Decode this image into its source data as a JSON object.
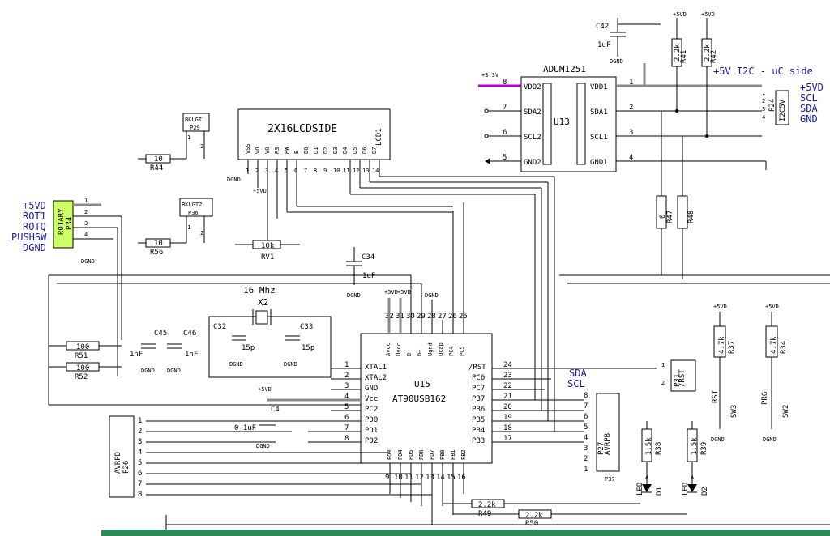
{
  "colors": {
    "wire": "#000000",
    "net_blue": "#1a1aa8",
    "bus_gray": "#8a8a8a",
    "rotary_fill": "#ccff66",
    "power_pin": "#b000c8",
    "bottom_band": "#2e8b57"
  },
  "components": {
    "adum": {
      "title": "ADUM1251",
      "ref": "U13",
      "left_pins": [
        {
          "num": "8",
          "name": "VDD2"
        },
        {
          "num": "7",
          "name": "SDA2"
        },
        {
          "num": "6",
          "name": "SCL2"
        },
        {
          "num": "5",
          "name": "GND2"
        }
      ],
      "right_pins": [
        {
          "num": "1",
          "name": "VDD1"
        },
        {
          "num": "2",
          "name": "SDA1"
        },
        {
          "num": "3",
          "name": "SCL1"
        },
        {
          "num": "4",
          "name": "GND1"
        }
      ]
    },
    "lcd": {
      "title": "2X16LCDSIDE",
      "ref": "LCD1",
      "pins": [
        "VSS",
        "VO",
        "VO",
        "RS",
        "RW",
        "E",
        "D0",
        "D1",
        "D2",
        "D3",
        "D4",
        "D5",
        "D6",
        "D7"
      ],
      "pin_nums": [
        "1",
        "2",
        "3",
        "4",
        "5",
        "6",
        "7",
        "8",
        "9",
        "10",
        "11",
        "12",
        "13",
        "14"
      ]
    },
    "mcu": {
      "ref": "U15",
      "part": "AT90USB162",
      "left": [
        {
          "num": "1",
          "name": "XTAL1"
        },
        {
          "num": "2",
          "name": "XTAL2"
        },
        {
          "num": "3",
          "name": "GND"
        },
        {
          "num": "4",
          "name": "Vcc"
        },
        {
          "num": "5",
          "name": "PC2"
        },
        {
          "num": "6",
          "name": "PD0"
        },
        {
          "num": "7",
          "name": "PD1"
        },
        {
          "num": "8",
          "name": "PD2"
        }
      ],
      "right": [
        {
          "num": "24",
          "name": "/RST"
        },
        {
          "num": "23",
          "name": "PC6"
        },
        {
          "num": "22",
          "name": "PC7"
        },
        {
          "num": "21",
          "name": "PB7"
        },
        {
          "num": "20",
          "name": "PB6"
        },
        {
          "num": "19",
          "name": "PB5"
        },
        {
          "num": "18",
          "name": "PB4"
        },
        {
          "num": "17",
          "name": "PB3"
        }
      ],
      "top": [
        {
          "num": "32",
          "name": "Avcc"
        },
        {
          "num": "31",
          "name": "Uvcc"
        },
        {
          "num": "30",
          "name": "D-"
        },
        {
          "num": "29",
          "name": "D+"
        },
        {
          "num": "28",
          "name": "Ugnd"
        },
        {
          "num": "27",
          "name": "Ucap"
        },
        {
          "num": "26",
          "name": "PC4"
        },
        {
          "num": "25",
          "name": "PC5"
        }
      ],
      "bottom": [
        {
          "num": "9",
          "name": "PD3"
        },
        {
          "num": "10",
          "name": "PD4"
        },
        {
          "num": "11",
          "name": "PD5"
        },
        {
          "num": "12",
          "name": "PD6"
        },
        {
          "num": "13",
          "name": "PD7"
        },
        {
          "num": "14",
          "name": "PB0"
        },
        {
          "num": "15",
          "name": "PB1"
        },
        {
          "num": "16",
          "name": "PB2"
        }
      ]
    },
    "crystal": {
      "ref": "X2",
      "freq": "16 Mhz"
    },
    "caps": [
      {
        "ref": "C42",
        "value": "1uF"
      },
      {
        "ref": "C34",
        "value": "1uF"
      },
      {
        "ref": "C32",
        "value": "15p"
      },
      {
        "ref": "C33",
        "value": "15p"
      },
      {
        "ref": "C45",
        "value": "1nF"
      },
      {
        "ref": "C46",
        "value": "1nF"
      },
      {
        "ref": "C4",
        "value": "0 1uF"
      }
    ],
    "resistors": [
      {
        "ref": "R41",
        "value": "2.2k"
      },
      {
        "ref": "R42",
        "value": "2.2k"
      },
      {
        "ref": "R47",
        "value": "0"
      },
      {
        "ref": "R48",
        "value": "0"
      },
      {
        "ref": "R44",
        "value": "10"
      },
      {
        "ref": "R56",
        "value": "10"
      },
      {
        "ref": "R51",
        "value": "100"
      },
      {
        "ref": "R52",
        "value": "100"
      },
      {
        "ref": "R37",
        "value": "4.7k"
      },
      {
        "ref": "R34",
        "value": "4.7k"
      },
      {
        "ref": "R38",
        "value": "1.5k"
      },
      {
        "ref": "R39",
        "value": "1.5k"
      },
      {
        "ref": "R49",
        "value": "2.2k"
      },
      {
        "ref": "R50",
        "value": "2.2k"
      }
    ],
    "pot": {
      "ref": "RV1",
      "value": "10k"
    },
    "headers": {
      "p29": {
        "ref": "P29",
        "label": "BKLGT",
        "pins": [
          "1",
          "2"
        ]
      },
      "p36": {
        "ref": "P36",
        "label": "BKLGT2",
        "pins": [
          "1",
          "2"
        ]
      },
      "p34": {
        "ref": "P34",
        "label": "ROTARY",
        "pins": [
          "1",
          "2",
          "3",
          "4"
        ]
      },
      "p24": {
        "ref": "P24",
        "label": "I2C5V",
        "pins": [
          "1",
          "2",
          "3",
          "4"
        ]
      },
      "p31": {
        "ref": "P31",
        "label": "/RST",
        "pins": [
          "1",
          "2"
        ]
      },
      "p27": {
        "ref": "P27",
        "label": "AVRPB",
        "pins": [
          "8",
          "7",
          "6",
          "5",
          "4",
          "3",
          "2",
          "1"
        ]
      },
      "p26": {
        "ref": "P26",
        "label": "AVRPD",
        "pins": [
          "1",
          "2",
          "3",
          "4",
          "5",
          "6",
          "7",
          "8"
        ]
      },
      "p37": {
        "ref": "P37"
      }
    },
    "switches": [
      {
        "ref": "SW3",
        "label": "RST"
      },
      {
        "ref": "SW2",
        "label": "PRG"
      }
    ],
    "leds": [
      {
        "ref": "D1",
        "label": "LED",
        "pin": "A"
      },
      {
        "ref": "D2",
        "label": "LED",
        "pin": "A"
      }
    ]
  },
  "nets": {
    "i2c_title": "+5V I2C - uC side",
    "i2c_pins": [
      "+5VD",
      "SCL",
      "SDA",
      "GND"
    ],
    "rotary_nets": [
      "+5VD",
      "ROT1",
      "ROTQ",
      "PUSHSW",
      "DGND"
    ],
    "mcu_nets": [
      "SDA",
      "SCL"
    ],
    "power": {
      "p5vd": "+5VD",
      "dgnd": "DGND",
      "v33": "+3.3V"
    }
  }
}
